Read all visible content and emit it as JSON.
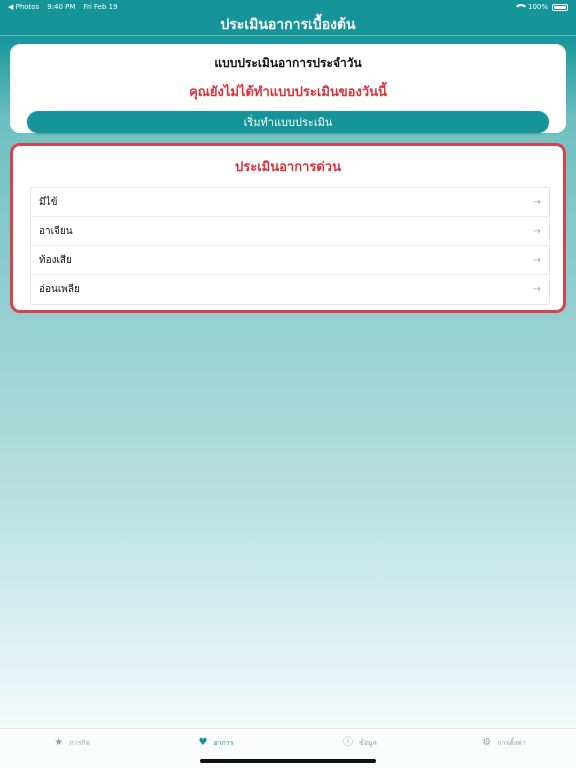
{
  "status_bar": {
    "back_app": "◀ Photos",
    "time": "9:40 PM",
    "date": "Fri Feb 19",
    "battery": "100%"
  },
  "nav": {
    "title": "ประเมินอาการเบื้องต้น"
  },
  "daily": {
    "title": "แบบประเมินอาการประจำวัน",
    "warning": "คุณยังไม่ได้ทำแบบประเมินของวันนี้",
    "start_label": "เริ่มทำแบบประเมิน"
  },
  "urgent": {
    "title": "ประเมินอาการด่วน",
    "items": [
      {
        "label": "มีไข้",
        "arrow": "→"
      },
      {
        "label": "อาเจียน",
        "arrow": "→"
      },
      {
        "label": "ท้องเสีย",
        "arrow": "→"
      },
      {
        "label": "อ่อนเพลีย",
        "arrow": "→"
      }
    ]
  },
  "tabs": [
    {
      "label": "ภารกิจ",
      "icon": "star-icon",
      "glyph": "★",
      "active": false
    },
    {
      "label": "อาการ",
      "icon": "heart-pulse-icon",
      "glyph": "♥",
      "active": true
    },
    {
      "label": "ข้อมูล",
      "icon": "info-icon",
      "glyph": "ⓘ",
      "active": false
    },
    {
      "label": "การตั้งค่า",
      "icon": "gear-icon",
      "glyph": "⚙",
      "active": false
    }
  ],
  "colors": {
    "accent": "#15959a",
    "warning": "#d9343b",
    "urgent_border": "#d9434a"
  }
}
